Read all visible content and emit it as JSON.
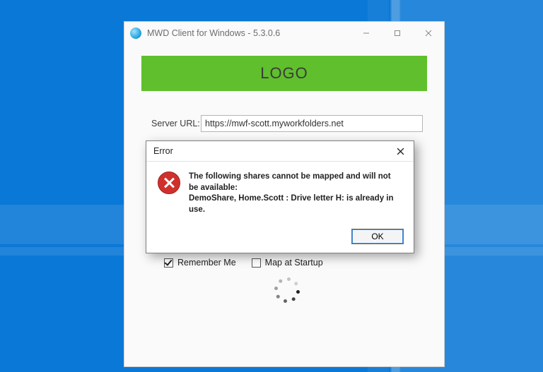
{
  "window": {
    "title": "MWD Client for Windows - 5.3.0.6",
    "logo_text": "LOGO"
  },
  "form": {
    "server_url_label": "Server URL:",
    "server_url_value": "https://mwf-scott.myworkfolders.net"
  },
  "checks": {
    "remember_label": "Remember Me",
    "remember_checked": true,
    "map_startup_label": "Map at Startup",
    "map_startup_checked": false
  },
  "dialog": {
    "title": "Error",
    "line1": "The following shares cannot be mapped and will not be available:",
    "line2": "DemoShare, Home.Scott : Drive letter H: is already in use.",
    "ok_label": "OK"
  }
}
